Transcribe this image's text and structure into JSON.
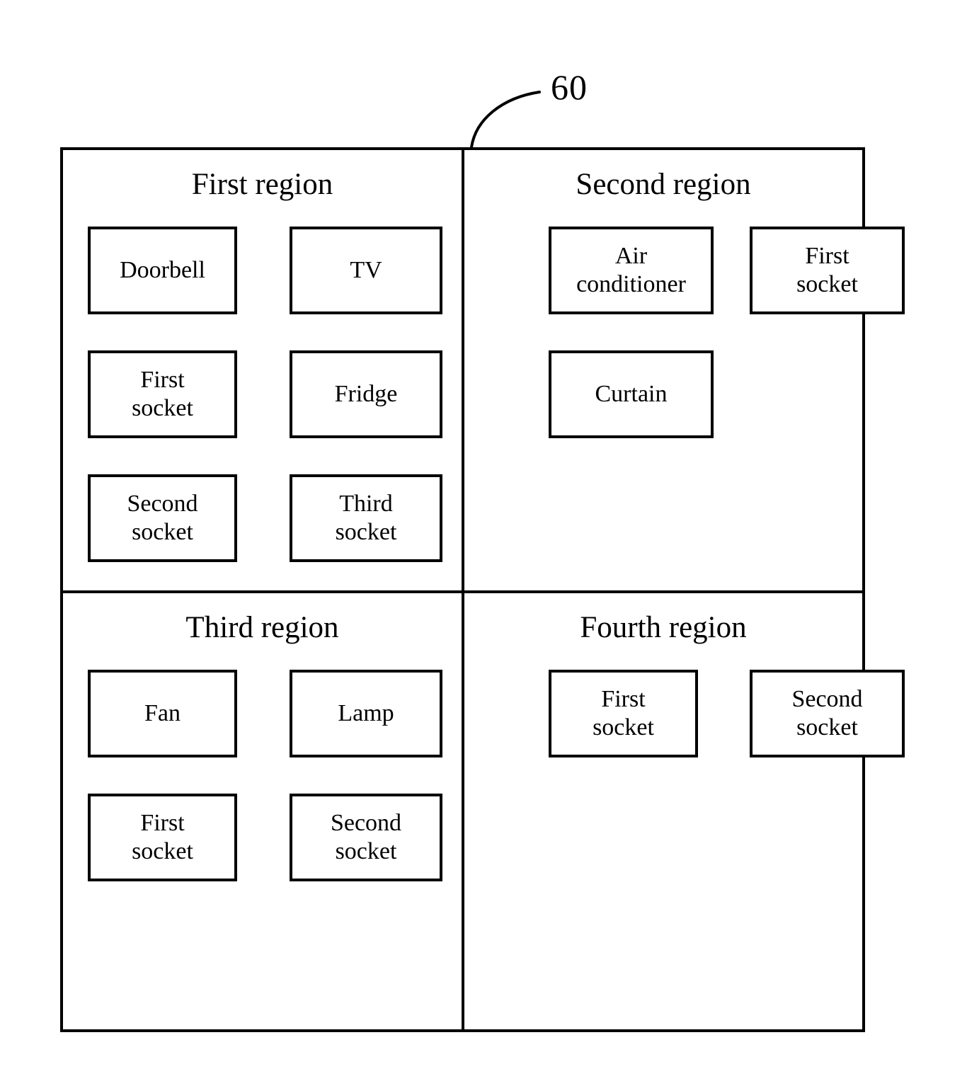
{
  "figure": {
    "reference_numeral": "60"
  },
  "regions": [
    {
      "title": "First region",
      "devices": [
        {
          "label": "Doorbell"
        },
        {
          "label": "TV"
        },
        {
          "label": "First\nsocket"
        },
        {
          "label": "Fridge"
        },
        {
          "label": "Second\nsocket"
        },
        {
          "label": "Third\nsocket"
        }
      ]
    },
    {
      "title": "Second region",
      "devices": [
        {
          "label": "Air\nconditioner"
        },
        {
          "label": "First\nsocket"
        },
        {
          "label": "Curtain"
        }
      ]
    },
    {
      "title": "Third region",
      "devices": [
        {
          "label": "Fan"
        },
        {
          "label": "Lamp"
        },
        {
          "label": "First\nsocket"
        },
        {
          "label": "Second\nsocket"
        }
      ]
    },
    {
      "title": "Fourth region",
      "devices": [
        {
          "label": "First\nsocket"
        },
        {
          "label": "Second\nsocket"
        }
      ]
    }
  ]
}
